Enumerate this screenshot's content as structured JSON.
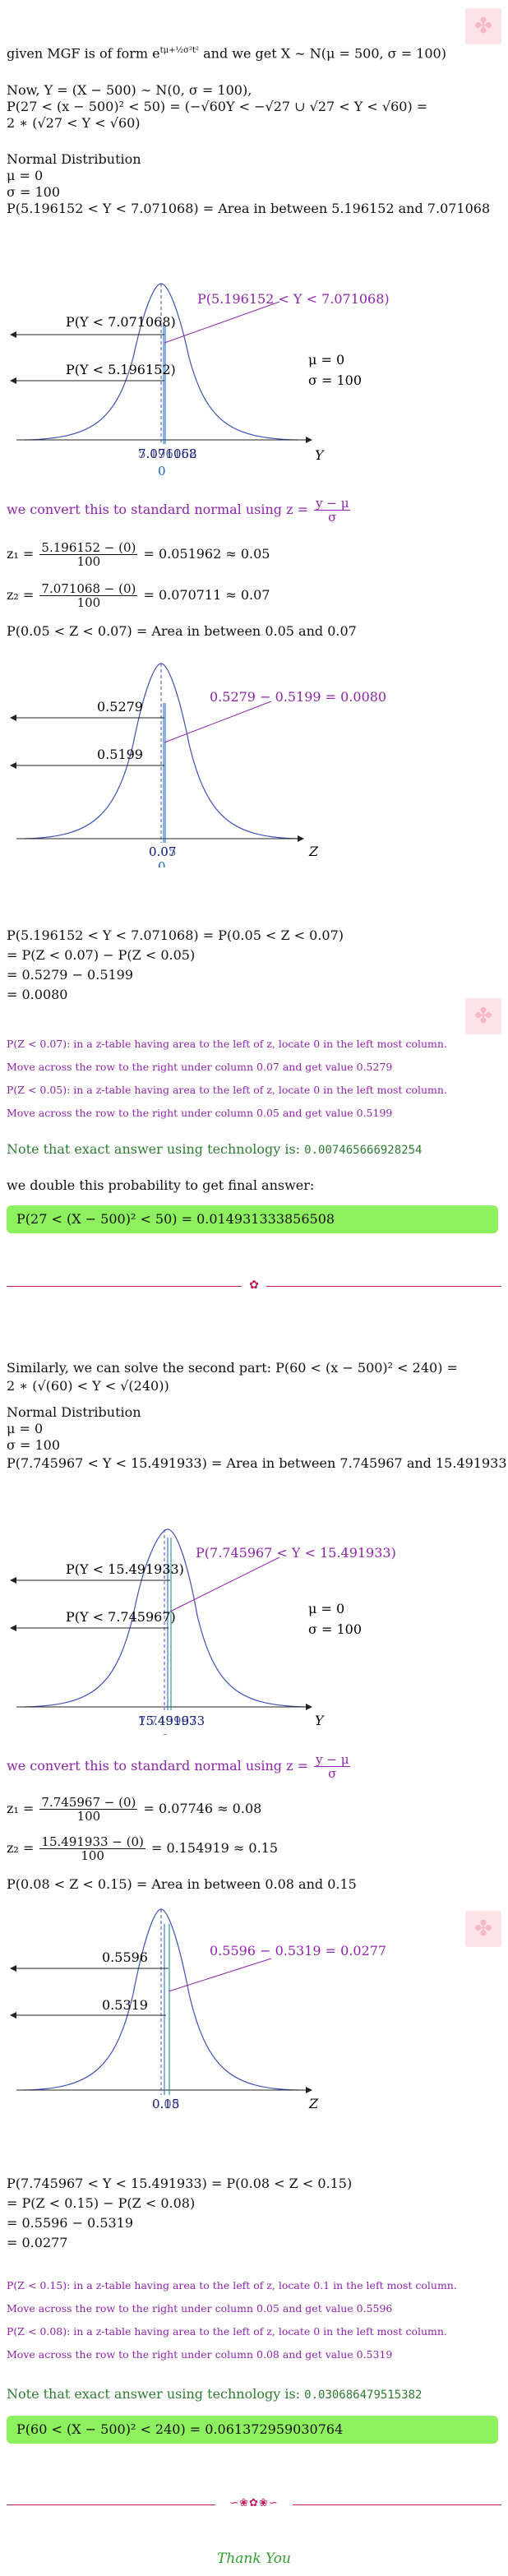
{
  "intro": {
    "l1_a": "given MGF is of form ",
    "l1_b": "e",
    "l1_sup": "tμ+½σ²t²",
    "l1_c": " and we get X ∼ N(μ = 500, σ = 100)",
    "l2": "Now, Y = (X − 500) ∼ N(0, σ = 100),",
    "l3": "P(27 < (x − 500)² < 50) = (−√60Y < −√27 ∪ √27 < Y < √60) =",
    "l4": "2 ∗ (√27 < Y < √60)"
  },
  "part1": {
    "nd_title": "Normal Distribution",
    "mu": "μ = 0",
    "sigma": "σ = 100",
    "area_line": "P(5.196152 < Y < 7.071068) = Area in between 5.196152 and 7.071068",
    "graph1": {
      "title": "P(5.196152 < Y < 7.071068)",
      "left_upper": "P(Y < 7.071068)",
      "left_lower": "P(Y < 5.196152)",
      "mu": "μ = 0",
      "sigma": "σ = 100",
      "axis": "Y",
      "tick_a": "7.071068",
      "tick_b": "5.196152",
      "zero": "0"
    },
    "convert_a": "we convert this to standard normal using z = ",
    "convert_num": "y − μ",
    "convert_den": "σ",
    "z1_lhs": "z₁ = ",
    "z1_num": "5.196152 − (0)",
    "z1_den": "100",
    "z1_rhs": " = 0.051962 ≈ 0.05",
    "z2_lhs": "z₂ = ",
    "z2_num": "7.071068 − (0)",
    "z2_den": "100",
    "z2_rhs": " = 0.070711 ≈ 0.07",
    "zarea": "P(0.05 < Z < 0.07) = Area in between 0.05 and 0.07",
    "graph2": {
      "title": "0.5279 − 0.5199 = 0.0080",
      "left_upper": "0.5279",
      "left_lower": "0.5199",
      "axis": "Z",
      "tick_a": "0.07",
      "tick_b": "0.05",
      "zero": "0"
    },
    "calc1": "P(5.196152 < Y < 7.071068) = P(0.05 < Z < 0.07)",
    "calc2": "= P(Z < 0.07) − P(Z < 0.05)",
    "calc3": "= 0.5279 − 0.5199",
    "calc4": "= 0.0080",
    "note1a": "P(Z < 0.07): in a z-table having area to the left of z, locate 0 in the left most column.",
    "note1b": "Move across the row to the right under column 0.07 and get value 0.5279",
    "note2a": "P(Z < 0.05): in a z-table having area to the left of z, locate 0 in the left most column.",
    "note2b": "Move across the row to the right under column 0.05 and get value 0.5199",
    "tech_label": "Note that exact answer using technology is: ",
    "tech_value": "0.007465666928254",
    "double": "we double this probability to get final answer:",
    "answer": "P(27 < (X − 500)² < 50) = 0.014931333856508"
  },
  "part2": {
    "intro1": "Similarly, we can solve the second part: P(60 < (x − 500)² < 240) =",
    "intro2": "2 ∗ (√(60) < Y < √(240))",
    "nd_title": "Normal Distribution",
    "mu": "μ = 0",
    "sigma": "σ = 100",
    "area_line": "P(7.745967 < Y < 15.491933) = Area in between 7.745967 and 15.491933",
    "graph1": {
      "title": "P(7.745967 < Y < 15.491933)",
      "left_upper": "P(Y < 15.491933)",
      "left_lower": "P(Y < 7.745967)",
      "mu": "μ = 0",
      "sigma": "σ = 100",
      "axis": "Y",
      "tick_a": "15.491933",
      "tick_b": "7.745967",
      "zero": "0"
    },
    "convert_a": "we convert this to standard normal using z = ",
    "convert_num": "y − μ",
    "convert_den": "σ",
    "z1_lhs": "z₁ = ",
    "z1_num": "7.745967 − (0)",
    "z1_den": "100",
    "z1_rhs": " = 0.07746 ≈ 0.08",
    "z2_lhs": "z₂ = ",
    "z2_num": "15.491933 − (0)",
    "z2_den": "100",
    "z2_rhs": " = 0.154919 ≈ 0.15",
    "zarea": "P(0.08 < Z < 0.15) = Area in between 0.08 and 0.15",
    "graph2": {
      "title": "0.5596 − 0.5319 = 0.0277",
      "left_upper": "0.5596",
      "left_lower": "0.5319",
      "axis": "Z",
      "tick_a": "0.15",
      "tick_b": "0.08",
      "zero": "0"
    },
    "calc1": "P(7.745967 < Y < 15.491933) = P(0.08 < Z < 0.15)",
    "calc2": "= P(Z < 0.15) − P(Z < 0.08)",
    "calc3": "= 0.5596 − 0.5319",
    "calc4": "= 0.0277",
    "note1a": "P(Z < 0.15): in a z-table having area to the left of z, locate 0.1 in the left most column.",
    "note1b": "Move across the row to the right under column 0.05 and get value 0.5596",
    "note2a": "P(Z < 0.08): in a z-table having area to the left of z, locate 0 in the left most column.",
    "note2b": "Move across the row to the right under column 0.08 and get value 0.5319",
    "tech_label": "Note that exact answer using technology is: ",
    "tech_value": "0.030686479515382",
    "answer": "P(60 < (X − 500)² < 240) = 0.061372959030764"
  },
  "footer": {
    "thanks": "Thank You"
  },
  "colors": {
    "purple": "#8e24aa",
    "green": "#2e7d32",
    "answer_bg": "#8ef05f",
    "curve": "#3f51b5"
  },
  "icons": {
    "watermark": "watermark-icon",
    "divider": "floral-divider-icon"
  }
}
